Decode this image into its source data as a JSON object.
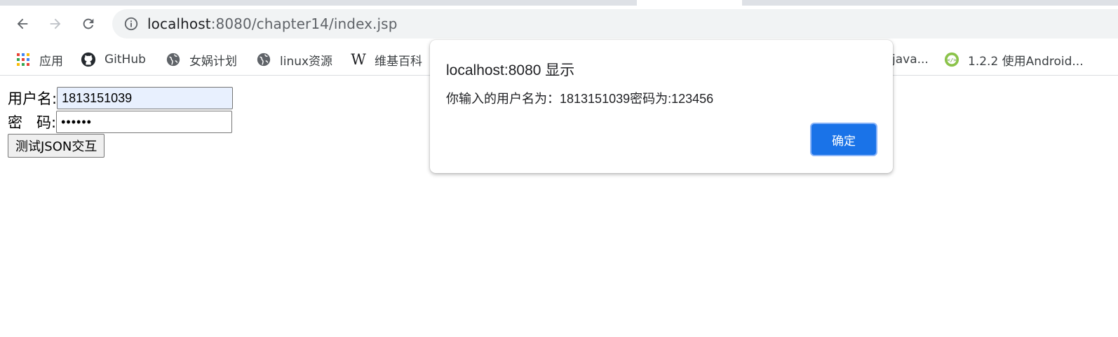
{
  "browser": {
    "url_host": "localhost",
    "url_rest": ":8080/chapter14/index.jsp"
  },
  "bookmarks": [
    {
      "label": "应用",
      "icon": "apps-grid-icon"
    },
    {
      "label": "GitHub",
      "icon": "github-icon"
    },
    {
      "label": "女娲计划",
      "icon": "globe-icon"
    },
    {
      "label": "linux资源",
      "icon": "globe-icon"
    },
    {
      "label": "维基百科",
      "icon": "wikipedia-icon"
    },
    {
      "label": "java...",
      "icon": ""
    },
    {
      "label": "1.2.2 使用Android...",
      "icon": "android-code-icon"
    }
  ],
  "form": {
    "username_label": "用户名:",
    "username_value": "1813151039",
    "password_label": "密   码:",
    "password_mask": "••••••",
    "submit_label": "测试JSON交互"
  },
  "dialog": {
    "title": "localhost:8080 显示",
    "message": "你输入的用户名为：1813151039密码为:123456",
    "ok_label": "确定"
  },
  "colors": {
    "accent": "#1a73e8",
    "autofill": "#e8f0fe"
  }
}
